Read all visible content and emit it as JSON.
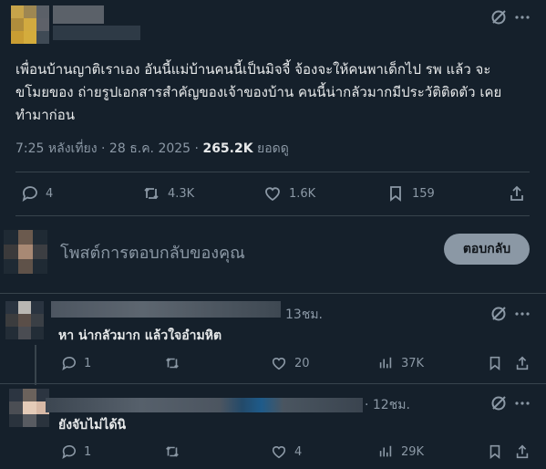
{
  "post": {
    "text_line1": "เพื่อนบ้านญาติเราเอง อันนี้แม่บ้านคนนี้เป็นมิจจี้ จ้องจะให้คนพาเด็กไป รพ แล้ว จะ",
    "text_line2": "ขโมยของ ถ่ายรูปเอกสารสำคัญของเจ้าของบ้าน คนนี้น่ากลัวมากมีประวัติติดตัว เคย",
    "text_line3": "ทำมาก่อน",
    "time": "7:25 หลังเที่ยง · 28 ธ.ค. 2025 · ",
    "views_count": "265.2K",
    "views_label": " ยอดดู",
    "replies": "4",
    "reposts": "4.3K",
    "likes": "1.6K",
    "bookmarks": "159"
  },
  "composer": {
    "placeholder": "โพสต์การตอบกลับของคุณ",
    "reply_button": "ตอบกลับ"
  },
  "replies": [
    {
      "time": "13ชม.",
      "text": "หา น่ากลัวมาก แล้วใจอำมหิต",
      "replies": "1",
      "reposts": "",
      "likes": "20",
      "views": "37K"
    },
    {
      "time": "· 12ชม.",
      "text": "ยังจับไม่ได้นิ",
      "replies": "1",
      "reposts": "",
      "likes": "4",
      "views": "29K"
    }
  ],
  "icons": {
    "grok": "grok-icon",
    "more": "more-icon",
    "reply": "reply-icon",
    "repost": "repost-icon",
    "like": "like-icon",
    "bookmark": "bookmark-icon",
    "share": "share-icon",
    "views": "views-icon"
  },
  "colors": {
    "background": "#15202b",
    "text": "#e7e9ea",
    "muted": "#8b98a5",
    "divider": "#38444d"
  }
}
